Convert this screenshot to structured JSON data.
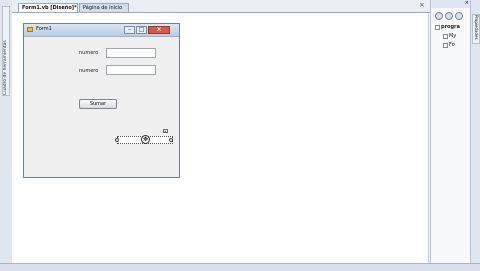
{
  "toolbox": {
    "label": "Cuadro de herramientas"
  },
  "tabs": {
    "designer": "Form1.vb [Diseño]*",
    "start_page": "Página de inicio",
    "close_glyph": "×"
  },
  "form": {
    "title": "Form1",
    "min_glyph": "–",
    "max_glyph": "□",
    "close_glyph": "×",
    "label_1": "numero",
    "label_2": "numero",
    "textbox_1": "",
    "textbox_2": "",
    "button_label": "Sumar",
    "move_glyph": "✥",
    "smart_tag_glyph": "▸"
  },
  "explorer": {
    "header_glyph": "×",
    "project": "progra",
    "my_project": "My",
    "form_file": "Fo"
  },
  "properties_strip": {
    "label": "Propiedades"
  },
  "colors": {
    "accent": "#b7cbe4",
    "close": "#d25a4b",
    "form_bg": "#efefef"
  }
}
